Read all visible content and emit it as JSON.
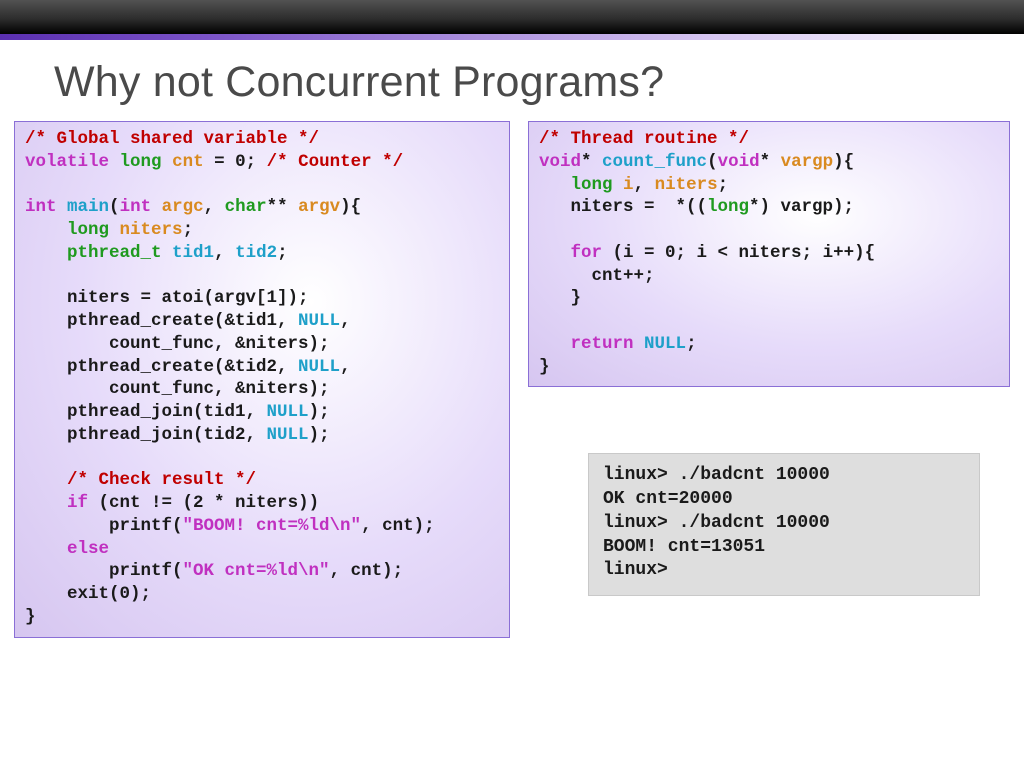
{
  "title": "Why not Concurrent Programs?",
  "left": {
    "l0": "/* Global shared variable */",
    "l1a": "volatile",
    "l1b": "long",
    "l1c": "cnt",
    "l1d": " = 0; ",
    "l1e": "/* Counter */",
    "l2a": "int",
    "l2b": "main",
    "l2c": "(",
    "l2d": "int",
    "l2e": "argc",
    "l2f": ", ",
    "l2g": "char",
    "l2h": "** ",
    "l2i": "argv",
    "l2j": "){",
    "l3a": "    ",
    "l3b": "long",
    "l3c": "niters",
    "l3d": ";",
    "l4a": "    ",
    "l4b": "pthread_t",
    "l4c": "tid1",
    "l4d": ", ",
    "l4e": "tid2",
    "l4f": ";",
    "l5": "    niters = atoi(argv[1]);",
    "l6a": "    pthread_create(&tid1, ",
    "l6b": "NULL",
    "l6c": ",",
    "l7": "        count_func, &niters);",
    "l8a": "    pthread_create(&tid2, ",
    "l8b": "NULL",
    "l8c": ",",
    "l9": "        count_func, &niters);",
    "l10a": "    pthread_join(tid1, ",
    "l10b": "NULL",
    "l10c": ");",
    "l11a": "    pthread_join(tid2, ",
    "l11b": "NULL",
    "l11c": ");",
    "l12a": "    ",
    "l12b": "/* Check result */",
    "l13a": "    ",
    "l13b": "if",
    "l13c": " (cnt != (2 * niters))",
    "l14a": "        printf(",
    "l14b": "\"BOOM! cnt=%ld\\n\"",
    "l14c": ", cnt);",
    "l15a": "    ",
    "l15b": "else",
    "l16a": "        printf(",
    "l16b": "\"OK cnt=%ld\\n\"",
    "l16c": ", cnt);",
    "l17": "    exit(0);",
    "l18": "}"
  },
  "right": {
    "r0": "/* Thread routine */",
    "r1a": "void",
    "r1b": "* ",
    "r1c": "count_func",
    "r1d": "(",
    "r1e": "void",
    "r1f": "* ",
    "r1g": "vargp",
    "r1h": "){",
    "r2a": "   ",
    "r2b": "long",
    "r2c": "i",
    "r2d": ", ",
    "r2e": "niters",
    "r2f": ";",
    "r3a": "   niters =  *((",
    "r3b": "long",
    "r3c": "*) vargp);",
    "r4a": "   ",
    "r4b": "for",
    "r4c": " (i = 0; i < niters; i++){",
    "r5": "     cnt++;",
    "r6": "   }",
    "r7a": "   ",
    "r7b": "return",
    "r7c": "NULL",
    "r7d": ";",
    "r8": "}"
  },
  "term": {
    "t0": "linux> ./badcnt 10000",
    "t1": "OK cnt=20000",
    "t2": "linux> ./badcnt 10000",
    "t3": "BOOM! cnt=13051",
    "t4": "linux>"
  }
}
